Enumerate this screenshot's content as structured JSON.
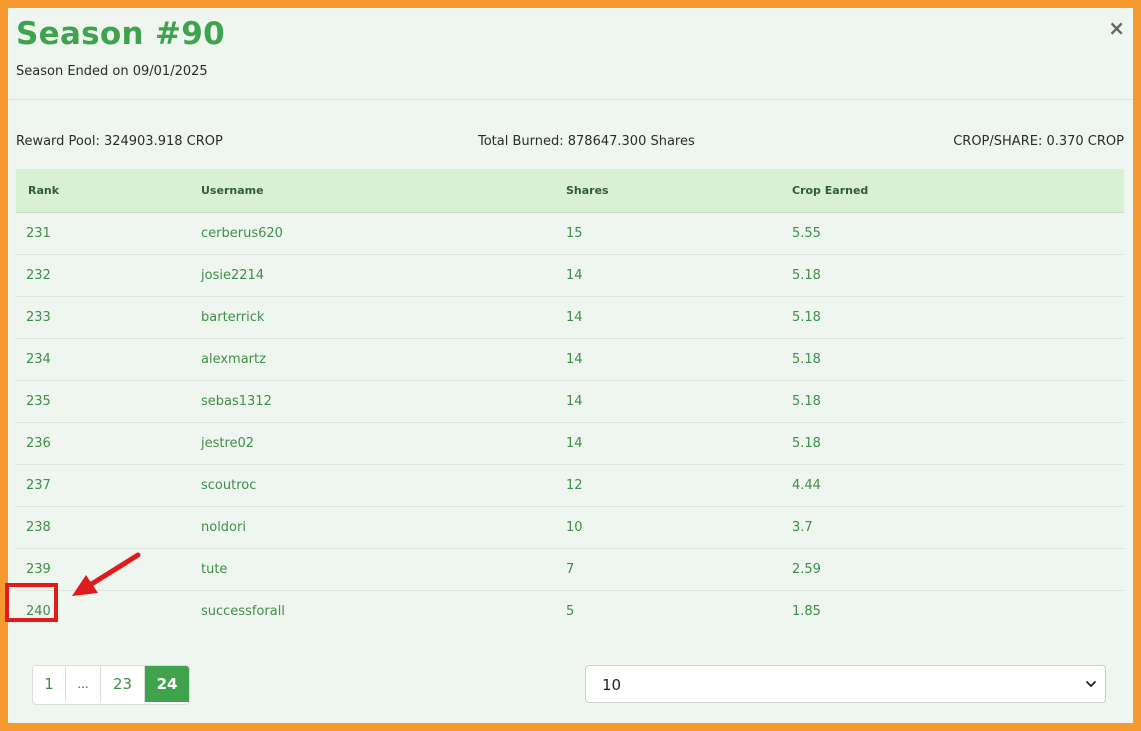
{
  "modal": {
    "title": "Season #90",
    "subtitle": "Season Ended on 09/01/2025",
    "close_label": "×"
  },
  "stats": {
    "reward_pool": "Reward Pool: 324903.918 CROP",
    "total_burned": "Total Burned: 878647.300 Shares",
    "crop_per_share": "CROP/SHARE: 0.370 CROP"
  },
  "table": {
    "headers": [
      "Rank",
      "Username",
      "Shares",
      "Crop Earned"
    ],
    "rows": [
      [
        "231",
        "cerberus620",
        "15",
        "5.55"
      ],
      [
        "232",
        "josie2214",
        "14",
        "5.18"
      ],
      [
        "233",
        "barterrick",
        "14",
        "5.18"
      ],
      [
        "234",
        "alexmartz",
        "14",
        "5.18"
      ],
      [
        "235",
        "sebas1312",
        "14",
        "5.18"
      ],
      [
        "236",
        "jestre02",
        "14",
        "5.18"
      ],
      [
        "237",
        "scoutroc",
        "12",
        "4.44"
      ],
      [
        "238",
        "noldori",
        "10",
        "3.7"
      ],
      [
        "239",
        "tute",
        "7",
        "2.59"
      ],
      [
        "240",
        "successforall",
        "5",
        "1.85"
      ]
    ]
  },
  "pagination": {
    "pages": [
      "1",
      "...",
      "23",
      "24"
    ],
    "active": "24"
  },
  "page_size": {
    "selected": "10"
  },
  "annotation": {
    "highlight_color": "#e01b1b"
  },
  "colors": {
    "accent": "#3fa34d",
    "frame": "#f49a2e"
  }
}
